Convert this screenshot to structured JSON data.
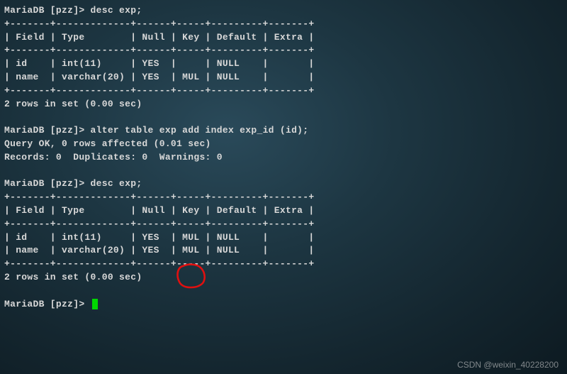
{
  "prompt": "MariaDB [pzz]>",
  "commands": {
    "desc1": "desc exp;",
    "alter": "alter table exp add index exp_id (id);",
    "desc2": "desc exp;",
    "empty": ""
  },
  "table1": {
    "border": "+-------+-------------+------+-----+---------+-------+",
    "header": "| Field | Type        | Null | Key | Default | Extra |",
    "rows": [
      "| id    | int(11)     | YES  |     | NULL    |       |",
      "| name  | varchar(20) | YES  | MUL | NULL    |       |"
    ]
  },
  "results": {
    "rows_in_set": "2 rows in set (0.00 sec)",
    "query_ok": "Query OK, 0 rows affected (0.01 sec)",
    "records": "Records: 0  Duplicates: 0  Warnings: 0"
  },
  "table2": {
    "border": "+-------+-------------+------+-----+---------+-------+",
    "header": "| Field | Type        | Null | Key | Default | Extra |",
    "rows": [
      "| id    | int(11)     | YES  | MUL | NULL    |       |",
      "| name  | varchar(20) | YES  | MUL | NULL    |       |"
    ]
  },
  "watermark": "CSDN @weixin_40228200",
  "annotation": {
    "color": "#e01010"
  }
}
